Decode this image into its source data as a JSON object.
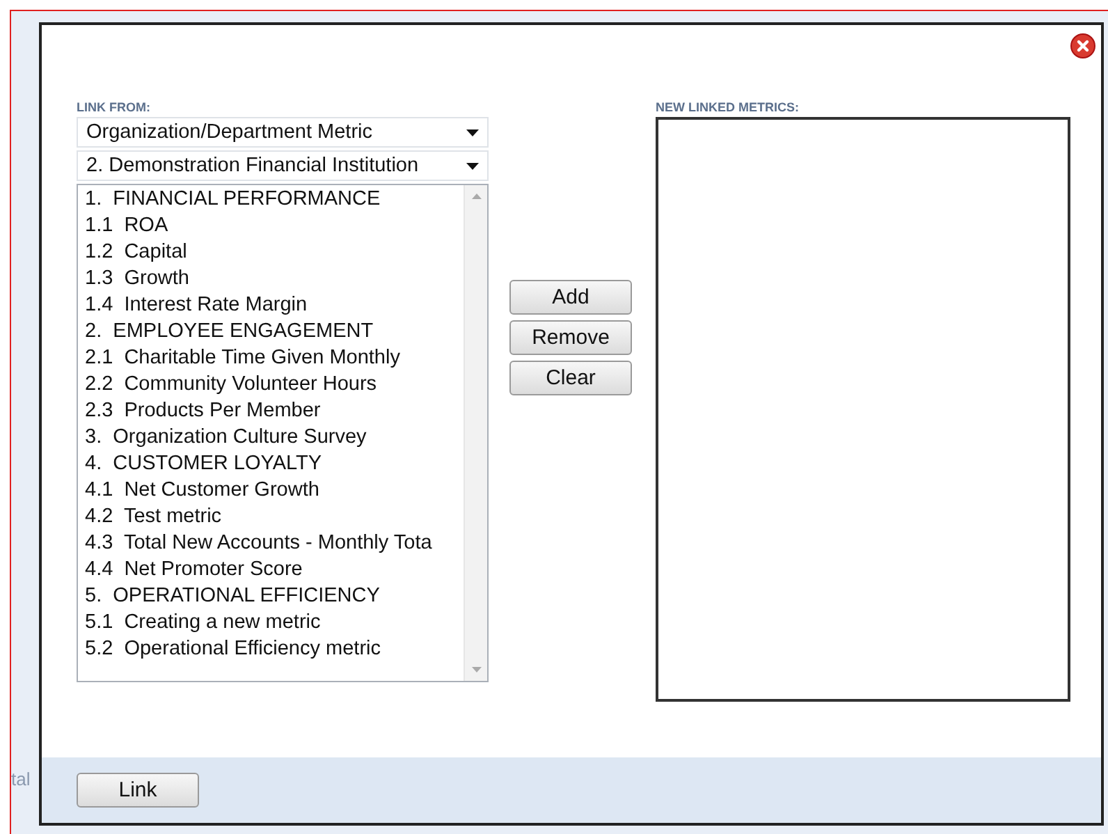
{
  "background": {
    "fragment": "tal"
  },
  "dialog": {
    "link_from": {
      "label": "LINK FROM:",
      "dropdowns": [
        {
          "value": "Organization/Department Metric"
        },
        {
          "value": "2.  Demonstration Financial Institution"
        }
      ],
      "items": [
        {
          "label": "1.  FINANCIAL PERFORMANCE"
        },
        {
          "label": "1.1  ROA"
        },
        {
          "label": "1.2  Capital"
        },
        {
          "label": "1.3  Growth"
        },
        {
          "label": "1.4  Interest Rate Margin"
        },
        {
          "label": "2.  EMPLOYEE ENGAGEMENT"
        },
        {
          "label": "2.1  Charitable Time Given Monthly"
        },
        {
          "label": "2.2  Community Volunteer Hours"
        },
        {
          "label": "2.3  Products Per Member"
        },
        {
          "label": "3.  Organization Culture Survey"
        },
        {
          "label": "4.  CUSTOMER LOYALTY"
        },
        {
          "label": "4.1  Net Customer Growth"
        },
        {
          "label": "4.2  Test metric"
        },
        {
          "label": "4.3  Total New Accounts - Monthly Tota"
        },
        {
          "label": "4.4  Net Promoter Score"
        },
        {
          "label": "5.  OPERATIONAL EFFICIENCY"
        },
        {
          "label": "5.1  Creating a new metric"
        },
        {
          "label": "5.2  Operational Efficiency metric"
        }
      ]
    },
    "actions": [
      "Add",
      "Remove",
      "Clear"
    ],
    "new_linked_metrics": {
      "label": "NEW LINKED METRICS:"
    },
    "footer_button": "Link"
  }
}
